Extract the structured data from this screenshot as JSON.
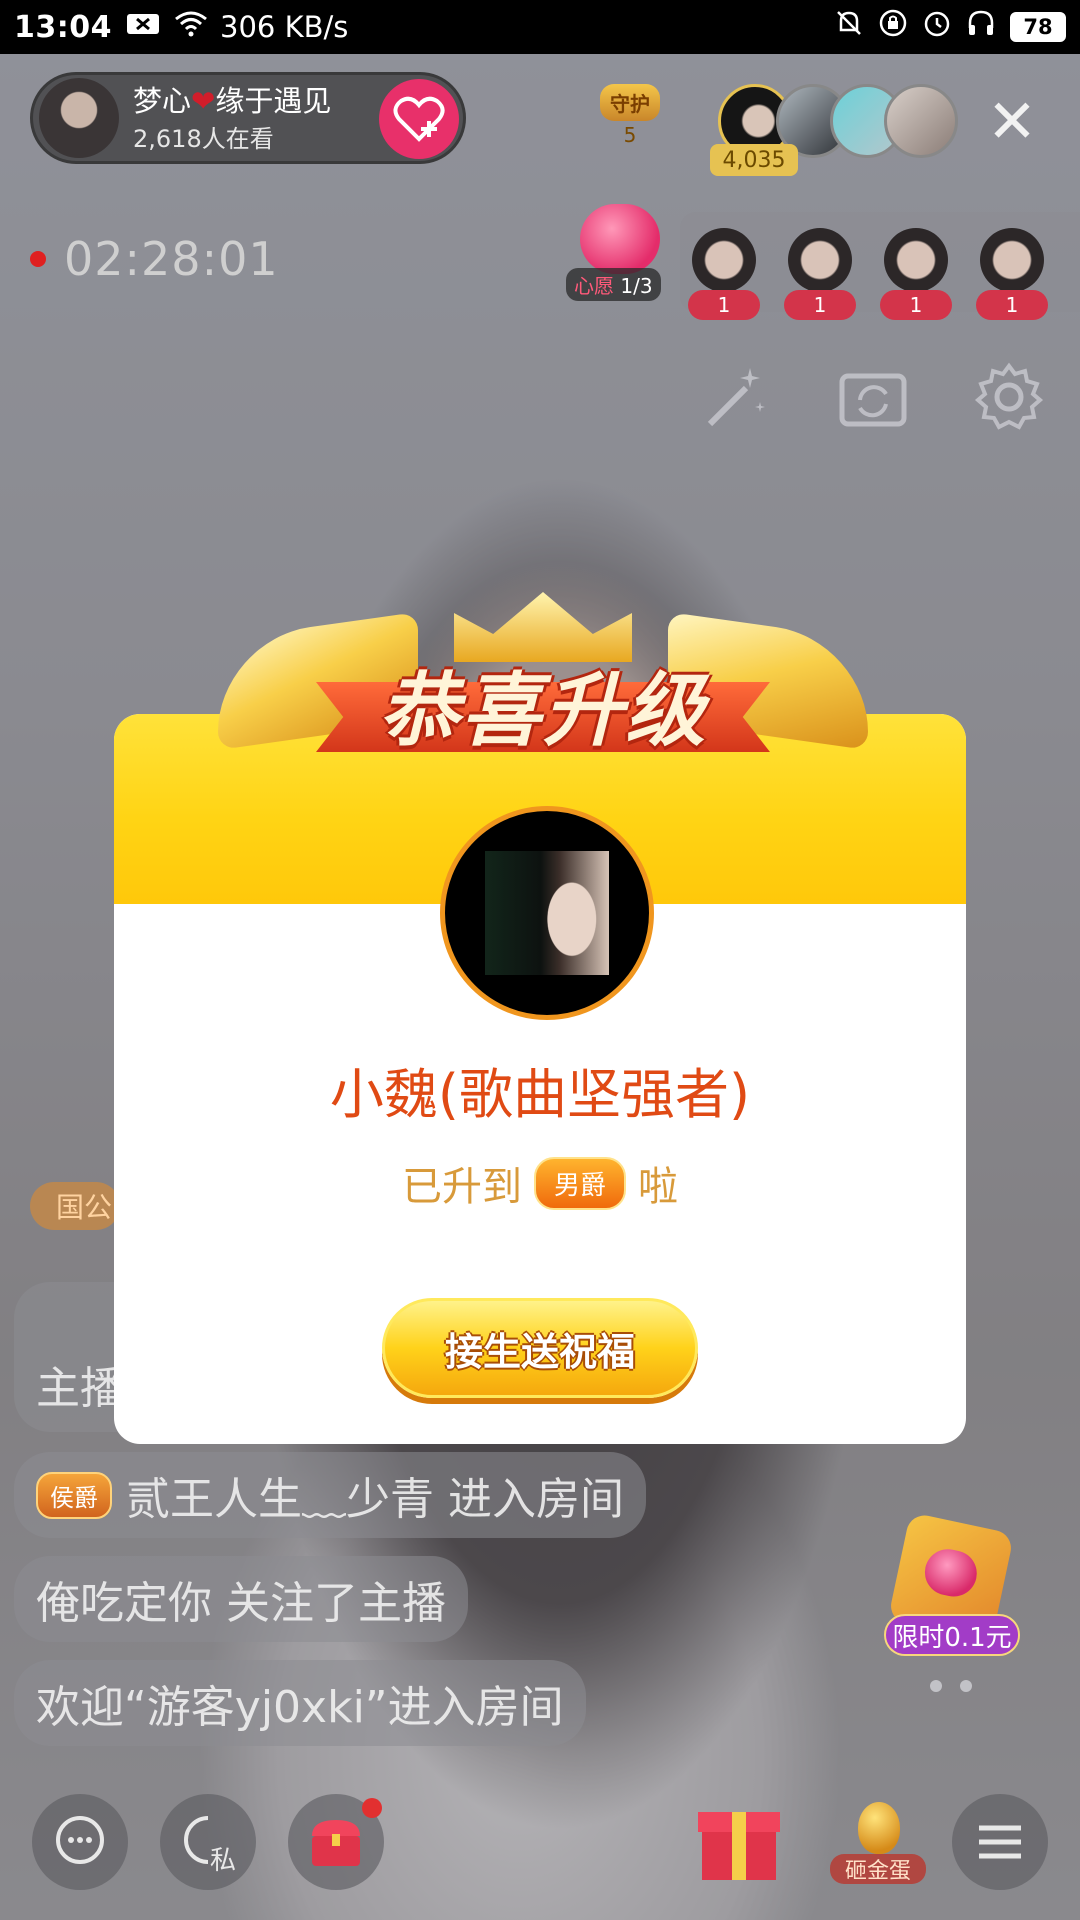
{
  "status_bar": {
    "time": "13:04",
    "speed": "306 KB/s",
    "battery": "78"
  },
  "host": {
    "name_part1": "梦心",
    "name_part2": "缘于遇见",
    "viewers": "2,618人在看"
  },
  "guard": {
    "label": "守护",
    "count": "5"
  },
  "viewer_total": "4,035",
  "stream_timer": "02:28:01",
  "wish": {
    "label": "心愿",
    "progress": "1/3"
  },
  "rank_list": [
    {
      "count": "1"
    },
    {
      "count": "1"
    },
    {
      "count": "1"
    },
    {
      "count": "1"
    }
  ],
  "chat": {
    "noble_tag": "国公",
    "messages": [
      {
        "tag": "",
        "text": "主播"
      },
      {
        "tag": "侯爵",
        "text": "贰王人生﹏少青 进入房间"
      },
      {
        "tag": "",
        "text": "俺吃定你  关注了主播"
      },
      {
        "tag": "",
        "text": "欢迎“游客yj0xki”进入房间"
      }
    ]
  },
  "promo": {
    "label": "限时0.1元"
  },
  "bottom_bar": {
    "private_label": "私",
    "egg_label": "砸金蛋"
  },
  "modal": {
    "title": "恭喜升级",
    "winner_name": "小魏(歌曲坚强者)",
    "level_prefix": "已升到",
    "level_badge": "男爵",
    "level_suffix": "啦",
    "cta_label": "接生送祝福"
  },
  "colors": {
    "accent_orange": "#e04a14",
    "gold": "#ffd414",
    "follow_pink": "#e8306a"
  }
}
